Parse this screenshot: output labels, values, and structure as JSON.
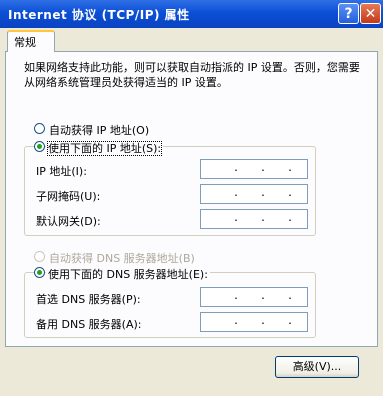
{
  "window": {
    "title": "Internet 协议 (TCP/IP) 属性",
    "help_glyph": "?",
    "close_glyph": "✕"
  },
  "tab": {
    "label": "常规"
  },
  "description": "如果网络支持此功能，则可以获取自动指派的 IP 设置。否则，您需要从网络系统管理员处获得适当的 IP 设置。",
  "ip": {
    "auto_label": "自动获得 IP 地址(O)",
    "manual_label": "使用下面的 IP 地址(S):",
    "selected": "manual",
    "fields": [
      {
        "label": "IP 地址(I):",
        "value": ""
      },
      {
        "label": "子网掩码(U):",
        "value": ""
      },
      {
        "label": "默认网关(D):",
        "value": ""
      }
    ]
  },
  "dns": {
    "auto_label": "自动获得 DNS 服务器地址(B)",
    "auto_disabled": true,
    "manual_label": "使用下面的 DNS 服务器地址(E):",
    "selected": "manual",
    "fields": [
      {
        "label": "首选 DNS 服务器(P):",
        "value": ""
      },
      {
        "label": "备用 DNS 服务器(A):",
        "value": ""
      }
    ]
  },
  "buttons": {
    "advanced": "高级(V)..."
  },
  "ip_dot": "."
}
